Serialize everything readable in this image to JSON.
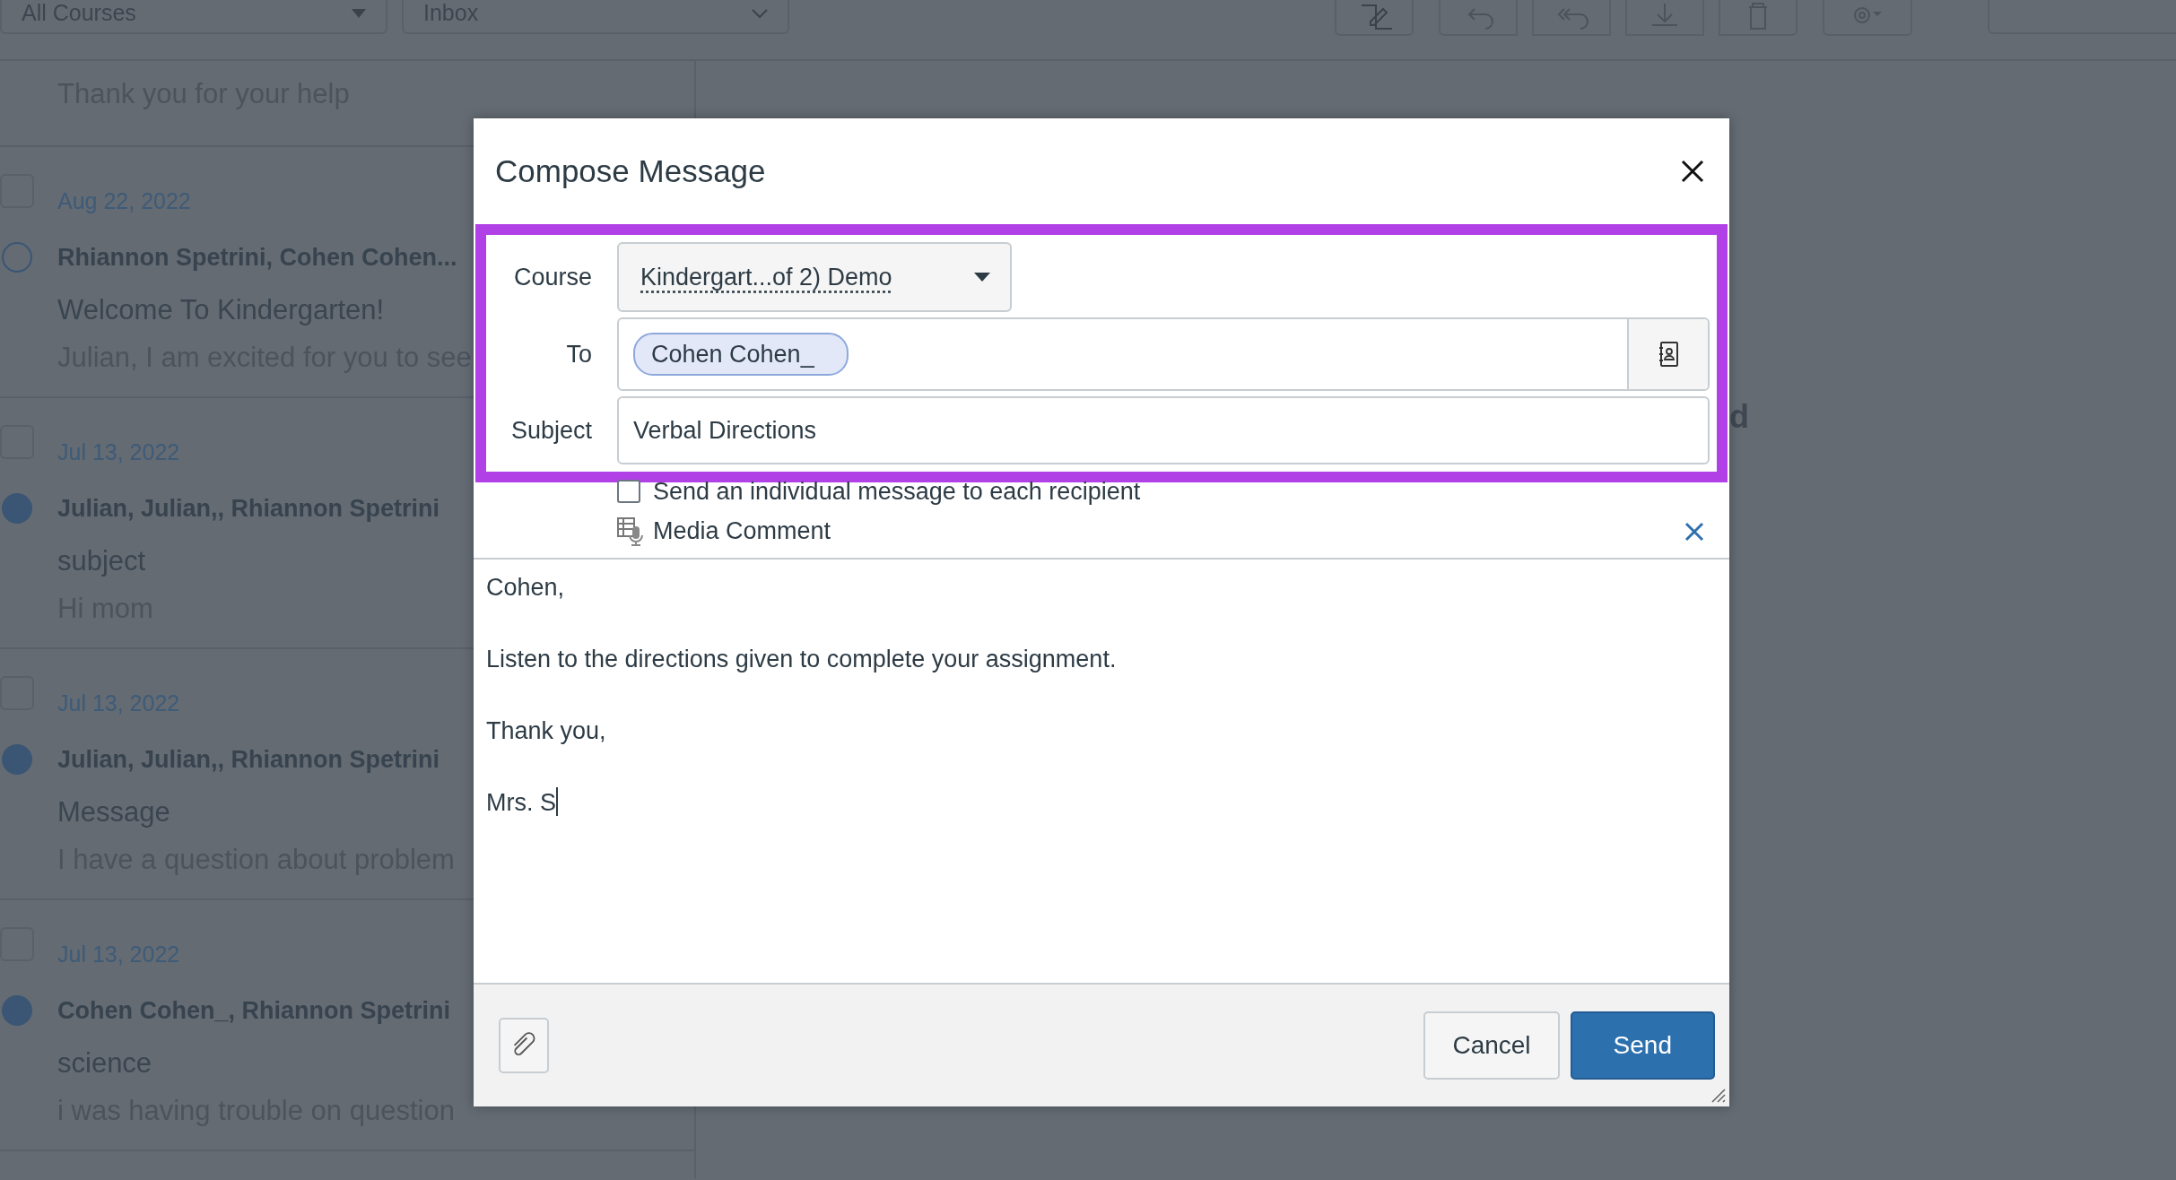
{
  "toolbar": {
    "course_filter": "All Courses",
    "mailbox_filter": "Inbox"
  },
  "conversations_cut": {
    "preview": "Thank you for your help"
  },
  "conversations": [
    {
      "date": "Aug 22, 2022",
      "checked": false,
      "unread": false,
      "participants": "Rhiannon Spetrini, Cohen Cohen...",
      "subject": "Welcome To Kindergarten!",
      "preview": "Julian, I am excited for you to see"
    },
    {
      "date": "Jul 13, 2022",
      "checked": false,
      "unread": true,
      "participants": "Julian, Julian,, Rhiannon Spetrini",
      "subject": "subject",
      "preview": "Hi mom"
    },
    {
      "date": "Jul 13, 2022",
      "checked": false,
      "unread": true,
      "participants": "Julian, Julian,, Rhiannon Spetrini",
      "subject": "Message",
      "preview": "I have a question about problem"
    },
    {
      "date": "Jul 13, 2022",
      "checked": false,
      "unread": true,
      "participants": "Cohen Cohen_, Rhiannon Spetrini",
      "subject": "science",
      "preview": "i was having trouble on question"
    }
  ],
  "detail_pane": {
    "heading_fragment": "d"
  },
  "dialog": {
    "title": "Compose Message",
    "course": {
      "label": "Course",
      "value": "Kindergart...of 2) Demo"
    },
    "to": {
      "label": "To",
      "recipients": [
        "Cohen Cohen_"
      ]
    },
    "subject": {
      "label": "Subject",
      "value": "Verbal Directions"
    },
    "individual": {
      "label": "Send an individual message to each recipient",
      "checked": false
    },
    "media_comment": {
      "label": "Media Comment"
    },
    "body": [
      "Cohen,",
      "Listen to the directions given to complete your assignment.",
      "Thank you,",
      "Mrs. S"
    ],
    "buttons": {
      "cancel": "Cancel",
      "send": "Send"
    }
  }
}
